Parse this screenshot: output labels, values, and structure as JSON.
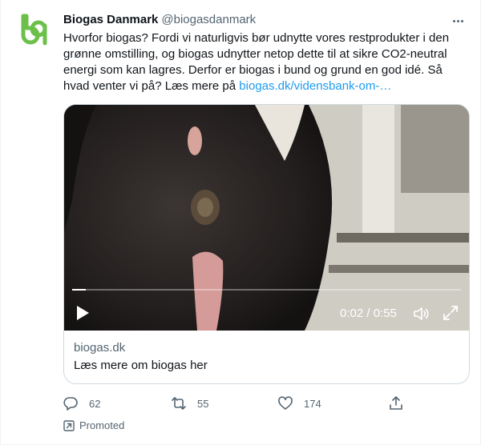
{
  "tweet": {
    "display_name": "Biogas Danmark",
    "handle": "@biogasdanmark",
    "text": "Hvorfor biogas? Fordi vi naturligvis bør udnytte vores restprodukter i den grønne omstilling, og biogas udnytter netop dette til at sikre CO2-neutral energi som kan lagres. Derfor er biogas i bund og grund en god idé. Så hvad venter vi på? Læs mere på ",
    "link_text": "biogas.dk/vidensbank-om-…"
  },
  "video": {
    "time": "0:02 / 0:55",
    "progress": 0.036
  },
  "card": {
    "domain": "biogas.dk",
    "title": "Læs mere om biogas her"
  },
  "actions": {
    "replies": "62",
    "retweets": "55",
    "likes": "174"
  },
  "promoted_label": "Promoted",
  "colors": {
    "brand_green": "#6cc04a",
    "link": "#1d9bf0",
    "secondary": "#536471"
  },
  "icons": [
    "biogas-logo-icon",
    "more-icon",
    "play-icon",
    "volume-icon",
    "fullscreen-icon",
    "reply-icon",
    "retweet-icon",
    "like-icon",
    "share-icon",
    "promoted-icon"
  ]
}
